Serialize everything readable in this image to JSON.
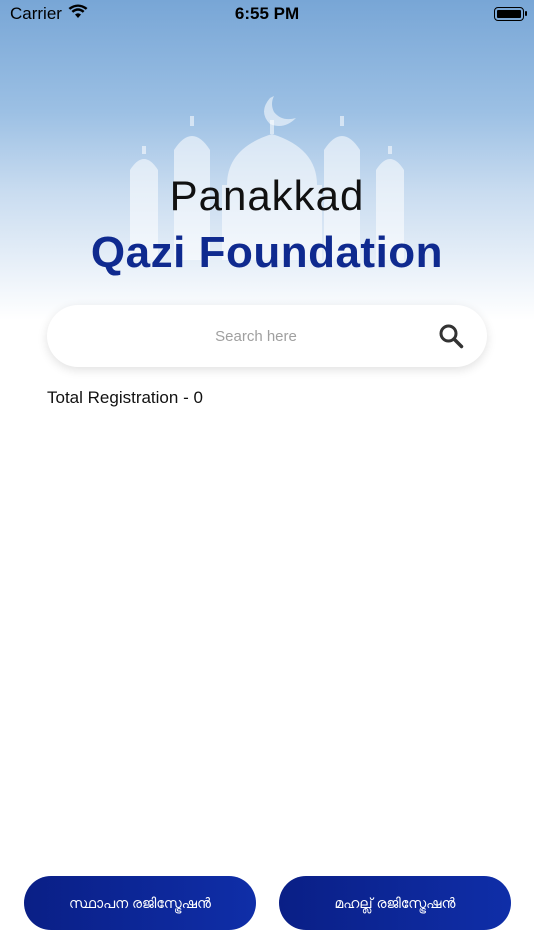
{
  "status_bar": {
    "carrier": "Carrier",
    "time": "6:55 PM",
    "wifi_icon": "wifi-icon",
    "battery_icon": "battery-icon"
  },
  "header": {
    "title_line1": "Panakkad",
    "title_line2": "Qazi Foundation",
    "background_icon": "mosque-icon"
  },
  "search": {
    "placeholder": "Search here",
    "value": "",
    "icon": "search-icon"
  },
  "summary": {
    "total_registration": "Total Registration - 0"
  },
  "actions": {
    "left_button_label": "സ്ഥാപന രജിസ്ട്രേഷൻ",
    "right_button_label": "മഹല്ല് രജിസ്ട്രേഷൻ"
  },
  "colors": {
    "brand_blue": "#0f2a8f",
    "button_gradient_start": "#0a1f86",
    "button_gradient_end": "#0f2ea8",
    "hero_top": "#78a6d6"
  }
}
